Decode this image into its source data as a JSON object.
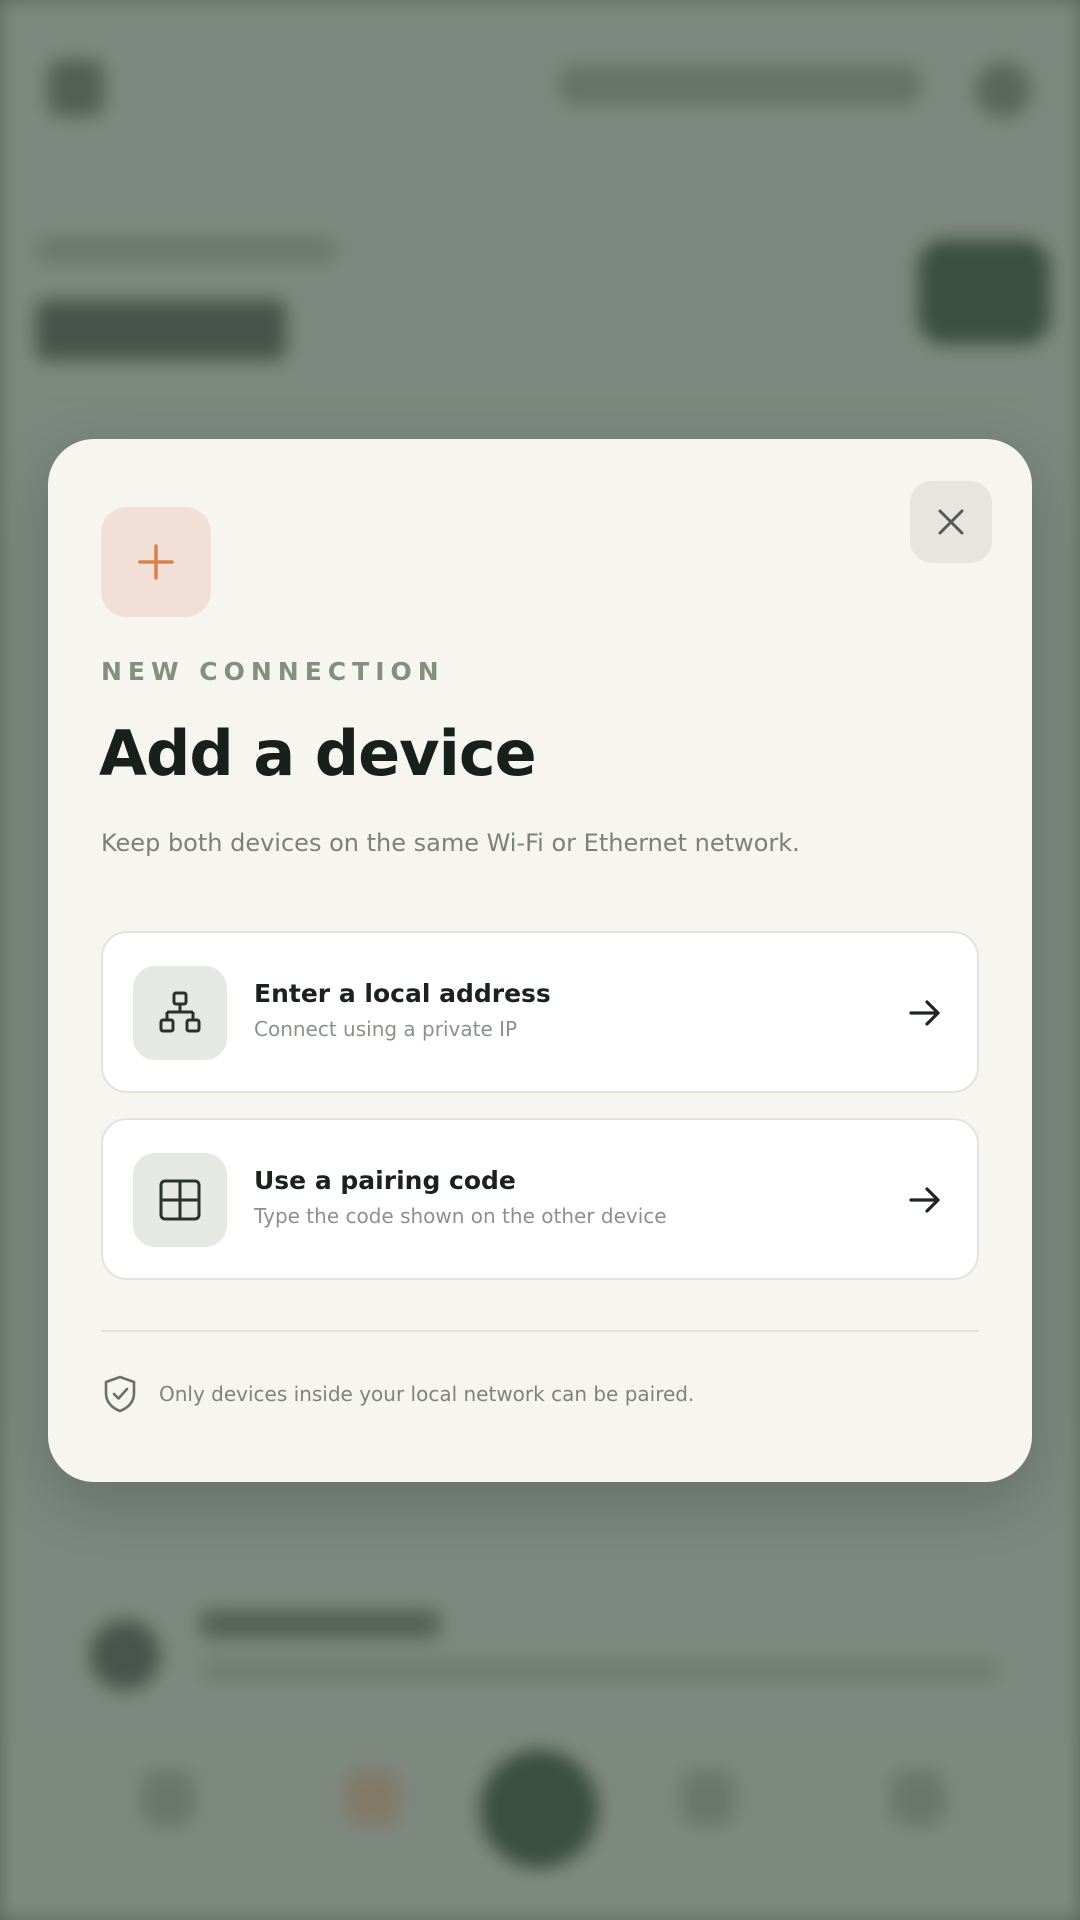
{
  "modal": {
    "eyebrow": "NEW CONNECTION",
    "title": "Add a device",
    "subtitle": "Keep both devices on the same Wi-Fi or Ethernet network.",
    "close_icon": "close-icon",
    "badge_icon": "plus-icon",
    "options": [
      {
        "title": "Enter a local address",
        "subtitle": "Connect using a private IP",
        "icon": "network-topology-icon"
      },
      {
        "title": "Use a pairing code",
        "subtitle": "Type the code shown on the other device",
        "icon": "grid-code-icon"
      }
    ],
    "footer": {
      "icon": "shield-check-icon",
      "text": "Only devices inside your local network can be paired."
    }
  },
  "colors": {
    "accent": "#d9824e",
    "badge_bg": "#f2dfd5",
    "card_bg": "#f6f5f0",
    "dark_text": "#17201b",
    "muted_text": "#7c817c",
    "eyebrow": "#84907f",
    "background_scrim": "#4e5c52"
  }
}
